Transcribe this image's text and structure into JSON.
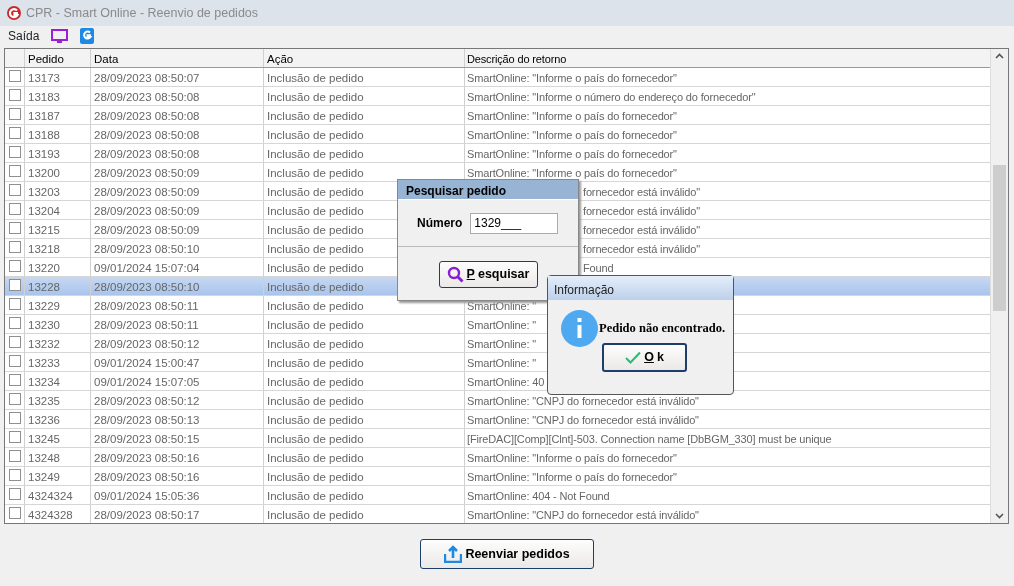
{
  "window": {
    "title": "CPR - Smart Online - Reenvio de pedidos"
  },
  "menu": {
    "label": "Saída"
  },
  "table": {
    "columns": [
      "Pedido",
      "Data",
      "Ação",
      "Descrição do retorno"
    ],
    "rows": [
      {
        "checked": false,
        "selected": false,
        "pedido": "13173",
        "data": "28/09/2023 08:50:07",
        "acao": "Inclusão de pedido",
        "descricao": "SmartOnline: \"Informe o país do fornecedor\""
      },
      {
        "checked": false,
        "selected": false,
        "pedido": "13183",
        "data": "28/09/2023 08:50:08",
        "acao": "Inclusão de pedido",
        "descricao": "SmartOnline: \"Informe o número do endereço do fornecedor\""
      },
      {
        "checked": false,
        "selected": false,
        "pedido": "13187",
        "data": "28/09/2023 08:50:08",
        "acao": "Inclusão de pedido",
        "descricao": "SmartOnline: \"Informe o país do fornecedor\""
      },
      {
        "checked": false,
        "selected": false,
        "pedido": "13188",
        "data": "28/09/2023 08:50:08",
        "acao": "Inclusão de pedido",
        "descricao": "SmartOnline: \"Informe o país do fornecedor\""
      },
      {
        "checked": false,
        "selected": false,
        "pedido": "13193",
        "data": "28/09/2023 08:50:08",
        "acao": "Inclusão de pedido",
        "descricao": "SmartOnline: \"Informe o país do fornecedor\""
      },
      {
        "checked": false,
        "selected": false,
        "pedido": "13200",
        "data": "28/09/2023 08:50:09",
        "acao": "Inclusão de pedido",
        "descricao": "SmartOnline: \"Informe o país do fornecedor\""
      },
      {
        "checked": false,
        "selected": false,
        "pedido": "13203",
        "data": "28/09/2023 08:50:09",
        "acao": "Inclusão de pedido",
        "descricao": "fornecedor está inválido\"",
        "covered_start": true
      },
      {
        "checked": false,
        "selected": false,
        "pedido": "13204",
        "data": "28/09/2023 08:50:09",
        "acao": "Inclusão de pedido",
        "descricao": "fornecedor está inválido\"",
        "covered_start": true
      },
      {
        "checked": false,
        "selected": false,
        "pedido": "13215",
        "data": "28/09/2023 08:50:09",
        "acao": "Inclusão de pedido",
        "descricao": "fornecedor está inválido\"",
        "covered_start": true
      },
      {
        "checked": false,
        "selected": false,
        "pedido": "13218",
        "data": "28/09/2023 08:50:10",
        "acao": "Inclusão de pedido",
        "descricao": "fornecedor está inválido\"",
        "covered_start": true
      },
      {
        "checked": false,
        "selected": false,
        "pedido": "13220",
        "data": "09/01/2024 15:07:04",
        "acao": "Inclusão de pedido",
        "descricao": "Found",
        "covered_start": true
      },
      {
        "checked": false,
        "selected": true,
        "pedido": "13228",
        "data": "28/09/2023 08:50:10",
        "acao": "Inclusão de pedido"
      },
      {
        "checked": false,
        "selected": false,
        "pedido": "13229",
        "data": "28/09/2023 08:50:11",
        "acao": "Inclusão de pedido",
        "descricao": "SmartOnline: \""
      },
      {
        "checked": false,
        "selected": false,
        "pedido": "13230",
        "data": "28/09/2023 08:50:11",
        "acao": "Inclusão de pedido",
        "descricao": "SmartOnline: \""
      },
      {
        "checked": false,
        "selected": false,
        "pedido": "13232",
        "data": "28/09/2023 08:50:12",
        "acao": "Inclusão de pedido",
        "descricao": "SmartOnline: \""
      },
      {
        "checked": false,
        "selected": false,
        "pedido": "13233",
        "data": "09/01/2024 15:00:47",
        "acao": "Inclusão de pedido",
        "descricao": "SmartOnline: \""
      },
      {
        "checked": false,
        "selected": false,
        "pedido": "13234",
        "data": "09/01/2024 15:07:05",
        "acao": "Inclusão de pedido",
        "descricao": "SmartOnline: 40"
      },
      {
        "checked": false,
        "selected": false,
        "pedido": "13235",
        "data": "28/09/2023 08:50:12",
        "acao": "Inclusão de pedido",
        "descricao": "SmartOnline: \"CNPJ do fornecedor está inválido\""
      },
      {
        "checked": false,
        "selected": false,
        "pedido": "13236",
        "data": "28/09/2023 08:50:13",
        "acao": "Inclusão de pedido",
        "descricao": "SmartOnline: \"CNPJ do fornecedor está inválido\""
      },
      {
        "checked": false,
        "selected": false,
        "pedido": "13245",
        "data": "28/09/2023 08:50:15",
        "acao": "Inclusão de pedido",
        "descricao": "[FireDAC][Comp][Clnt]-503. Connection name [DbBGM_330] must be unique"
      },
      {
        "checked": false,
        "selected": false,
        "pedido": "13248",
        "data": "28/09/2023 08:50:16",
        "acao": "Inclusão de pedido",
        "descricao": "SmartOnline: \"Informe o país do fornecedor\""
      },
      {
        "checked": false,
        "selected": false,
        "pedido": "13249",
        "data": "28/09/2023 08:50:16",
        "acao": "Inclusão de pedido",
        "descricao": "SmartOnline: \"Informe o país do fornecedor\""
      },
      {
        "checked": false,
        "selected": false,
        "pedido": "4324324",
        "data": "09/01/2024 15:05:36",
        "acao": "Inclusão de pedido",
        "descricao": "SmartOnline: 404 - Not Found"
      },
      {
        "checked": false,
        "selected": false,
        "pedido": "4324328",
        "data": "28/09/2023 08:50:17",
        "acao": "Inclusão de pedido",
        "descricao": "SmartOnline: \"CNPJ do fornecedor está inválido\""
      }
    ]
  },
  "resend_button": {
    "label": "Reenviar pedidos"
  },
  "search_dialog": {
    "title": "Pesquisar pedido",
    "field_label": "Número",
    "value": "1329___",
    "button": "Pesquisar"
  },
  "info_dialog": {
    "title": "Informação",
    "message": "Pedido não encontrado.",
    "button": "Ok"
  }
}
